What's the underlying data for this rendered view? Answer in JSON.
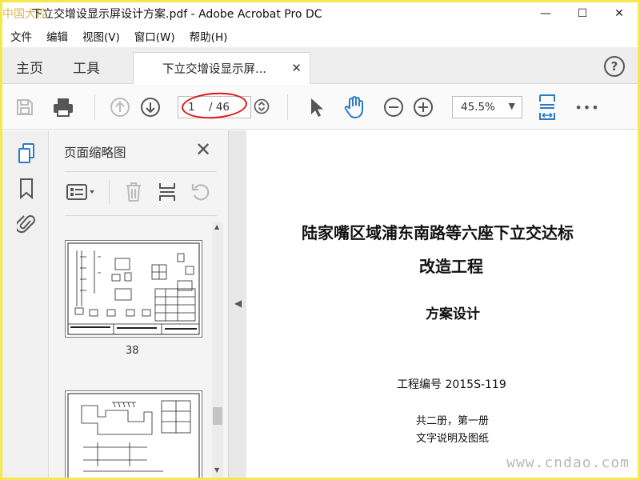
{
  "window": {
    "watermark_logo": "中国大控",
    "title": "下立交增设显示屏设计方案.pdf - Adobe Acrobat Pro DC",
    "minimize": "—",
    "maximize": "☐",
    "close": "✕"
  },
  "menu": [
    "文件",
    "编辑",
    "视图(V)",
    "窗口(W)",
    "帮助(H)"
  ],
  "tabs": {
    "home": "主页",
    "tools": "工具",
    "document": "下立交增设显示屏...",
    "help": "?"
  },
  "toolbar": {
    "current_page": "1",
    "total_pages": "/ 46",
    "zoom": "45.5%",
    "more": "•••"
  },
  "thumbnail_panel": {
    "title": "页面缩略图",
    "close": "✕",
    "thumbnails": [
      {
        "label": "38"
      }
    ]
  },
  "document": {
    "title_line1": "陆家嘴区域浦东南路等六座下立交达标",
    "title_line2": "改造工程",
    "subtitle": "方案设计",
    "project_no": "工程编号  2015S-119",
    "volume": "共二册，第一册",
    "contents": "文字说明及图纸"
  },
  "site_watermark": "www.cndao.com",
  "colors": {
    "accent_blue": "#2d7bc4",
    "annotation_red": "#e0141b",
    "frame_yellow": "#f5e84a"
  }
}
